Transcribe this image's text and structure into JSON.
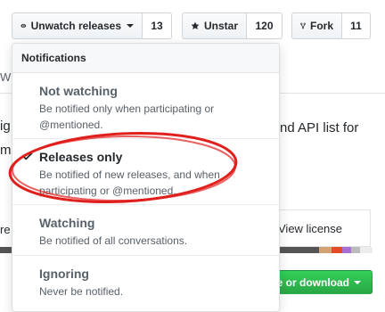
{
  "toolbar": {
    "watch": {
      "label": "Unwatch releases",
      "count": "13"
    },
    "star": {
      "label": "Unstar",
      "count": "120"
    },
    "fork": {
      "label": "Fork",
      "count": "11"
    }
  },
  "background": {
    "tab_fragment": "Wik",
    "text_right": "nd API list for",
    "text_left_1": "ig",
    "text_left_2": "m",
    "text_left_3": "re",
    "license_label": "View license",
    "clone_label": "ne or download",
    "lang_colors": [
      "#555555",
      "#e34c26",
      "#d4a373",
      "#563d7c",
      "#b07219",
      "#ededed"
    ]
  },
  "menu": {
    "header": "Notifications",
    "items": [
      {
        "title": "Not watching",
        "desc": "Be notified only when participating or @mentioned.",
        "selected": false
      },
      {
        "title": "Releases only",
        "desc": "Be notified of new releases, and when participating or @mentioned.",
        "selected": true
      },
      {
        "title": "Watching",
        "desc": "Be notified of all conversations.",
        "selected": false
      },
      {
        "title": "Ignoring",
        "desc": "Never be notified.",
        "selected": false
      }
    ]
  },
  "colors": {
    "annotation": "#e0201c",
    "primary_green": "#28a745"
  }
}
